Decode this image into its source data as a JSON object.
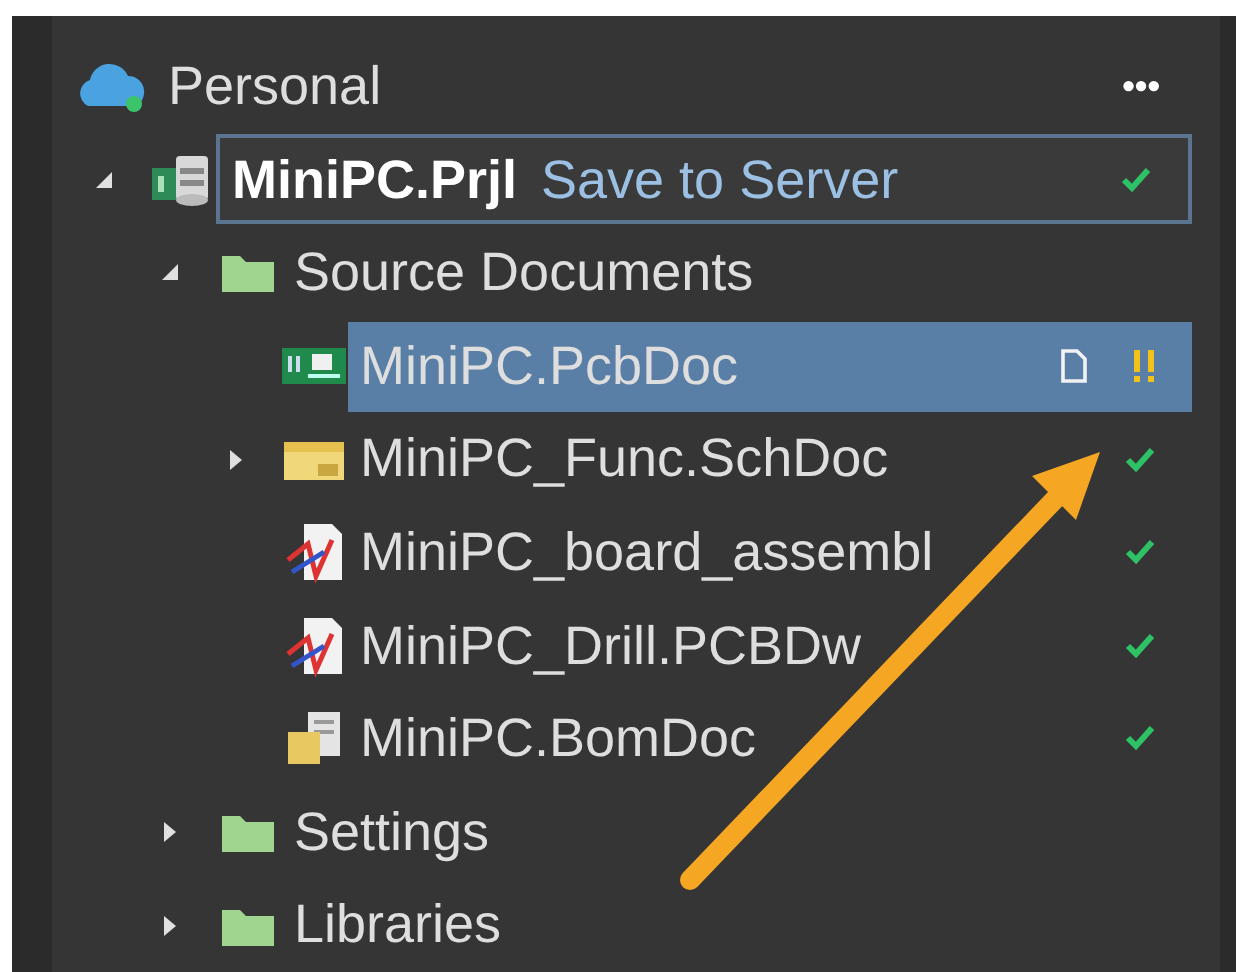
{
  "header": {
    "title": "Personal",
    "menu": "•••"
  },
  "tree": [
    {
      "name": "MiniPC.Prjl",
      "kind": "project",
      "expanded": true,
      "focused": true,
      "selected": false,
      "action": "Save to Server",
      "synced": true,
      "children": [
        {
          "name": "Source Documents",
          "kind": "folder",
          "expanded": true,
          "selected": false,
          "children": [
            {
              "name": "MiniPC.PcbDoc",
              "kind": "pcb",
              "selected": true,
              "synced": false,
              "modified": true
            },
            {
              "name": "MiniPC_Func.SchDoc",
              "kind": "sch",
              "expanded": false,
              "selected": false,
              "synced": true
            },
            {
              "name": "MiniPC_board_assembl",
              "kind": "drawing",
              "selected": false,
              "synced": true
            },
            {
              "name": "MiniPC_Drill.PCBDw",
              "kind": "drawing",
              "selected": false,
              "synced": true
            },
            {
              "name": "MiniPC.BomDoc",
              "kind": "bom",
              "selected": false,
              "synced": true
            }
          ]
        },
        {
          "name": "Settings",
          "kind": "folder",
          "expanded": false,
          "selected": false
        },
        {
          "name": "Libraries",
          "kind": "folder",
          "expanded": false,
          "selected": false
        }
      ]
    }
  ]
}
